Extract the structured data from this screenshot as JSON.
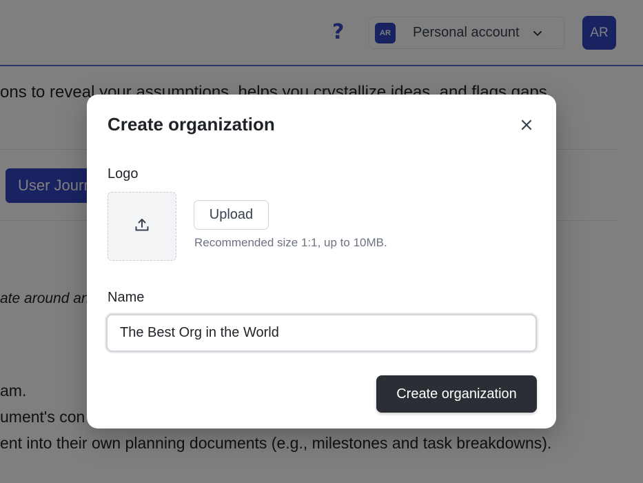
{
  "header": {
    "help_icon": "?",
    "account": {
      "avatar_initials": "AR",
      "label": "Personal account"
    },
    "user_avatar_initials": "AR"
  },
  "background": {
    "line1": "ons to reveal your assumptions, helps you crystallize ideas, and flags gaps",
    "button_label": "User Journ",
    "italic_line": "ate around an",
    "line2": "am.",
    "line3": "ument's con",
    "line4": "ent into their own planning documents (e.g., milestones and task breakdowns)."
  },
  "modal": {
    "title": "Create organization",
    "logo_label": "Logo",
    "upload_button": "Upload",
    "upload_hint": "Recommended size 1:1, up to 10MB.",
    "name_label": "Name",
    "name_value": "The Best Org in the World",
    "submit_button": "Create organization"
  },
  "colors": {
    "accent": "#3346c4",
    "primary_button": "#2b2e35",
    "overlay": "rgba(0,0,0,0.5)"
  },
  "icons": {
    "close": "close-icon",
    "upload": "upload-icon",
    "chevron": "chevron-down-icon",
    "help": "help-icon"
  }
}
